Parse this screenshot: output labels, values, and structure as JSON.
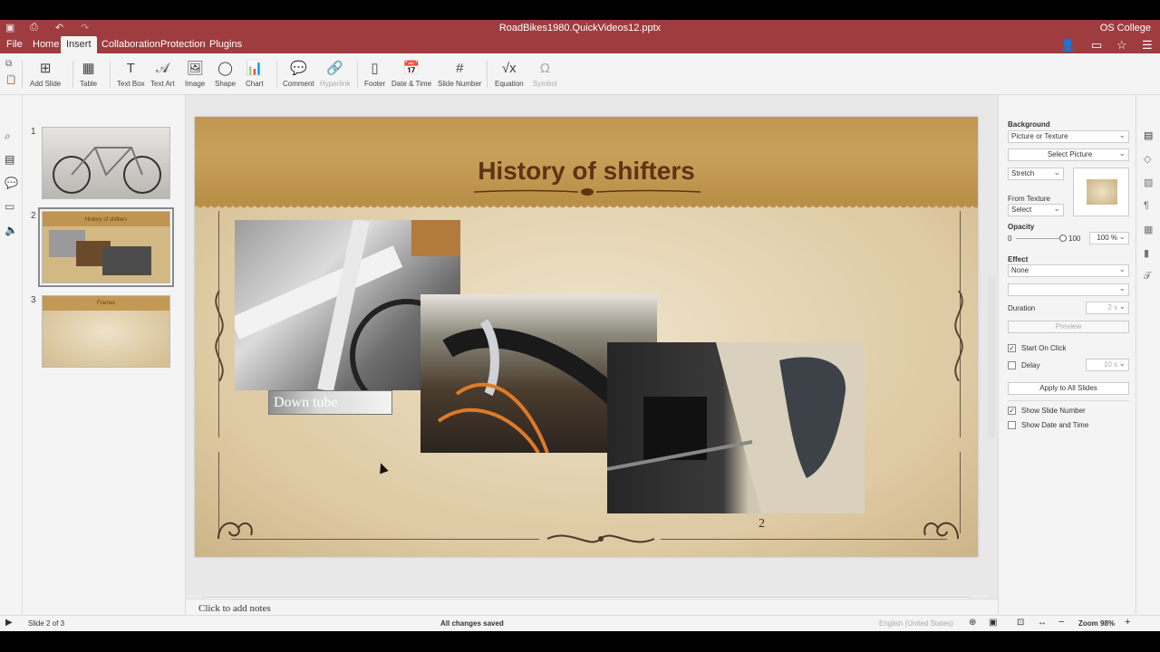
{
  "titlebar": {
    "document_name": "RoadBikes1980.QuickVideos12.pptx",
    "org": "OS College"
  },
  "menu": {
    "items": [
      "File",
      "Home",
      "Insert",
      "Collaboration",
      "Protection",
      "Plugins"
    ],
    "active": "Insert"
  },
  "toolbar": {
    "add_slide": "Add Slide",
    "table": "Table",
    "text_box": "Text Box",
    "text_art": "Text Art",
    "image": "Image",
    "shape": "Shape",
    "chart": "Chart",
    "comment": "Comment",
    "hyperlink": "Hyperlink",
    "footer": "Footer",
    "date_time": "Date & Time",
    "slide_number": "Slide Number",
    "equation": "Equation",
    "symbol": "Symbol"
  },
  "thumbnails": [
    {
      "number": "1",
      "title": "",
      "background": "#c8c6c2"
    },
    {
      "number": "2",
      "title": "History of shifters",
      "background": "#d2b882"
    },
    {
      "number": "3",
      "title": "Frames",
      "background": "#d9c7a0"
    }
  ],
  "slide": {
    "title": "History of shifters",
    "caption": "Down tube",
    "number": "2"
  },
  "notes": {
    "placeholder": "Click to add notes"
  },
  "right_panel": {
    "background_label": "Background",
    "background_value": "Picture or Texture",
    "select_picture": "Select Picture",
    "stretch": "Stretch",
    "from_texture_label": "From Texture",
    "texture_select": "Select",
    "opacity_label": "Opacity",
    "opacity_min": "0",
    "opacity_max": "100",
    "opacity_value": "100 %",
    "opacity_level": 100,
    "effect_label": "Effect",
    "effect_value": "None",
    "duration_label": "Duration",
    "duration_value": "2 s",
    "preview": "Preview",
    "start_on_click": "Start On Click",
    "start_on_click_checked": true,
    "delay_label": "Delay",
    "delay_checked": false,
    "delay_value": "10 s",
    "apply_all": "Apply to All Slides",
    "show_slide_number": "Show Slide Number",
    "show_slide_number_checked": true,
    "show_date_time": "Show Date and Time",
    "show_date_time_checked": false
  },
  "status": {
    "slide_indicator": "Slide 2 of 3",
    "save_state": "All changes saved",
    "language": "English (United States)",
    "zoom": "Zoom 98%"
  },
  "colors": {
    "brand": "#9e3c40",
    "title_text": "#5e3414",
    "banner": "#c39a53"
  }
}
